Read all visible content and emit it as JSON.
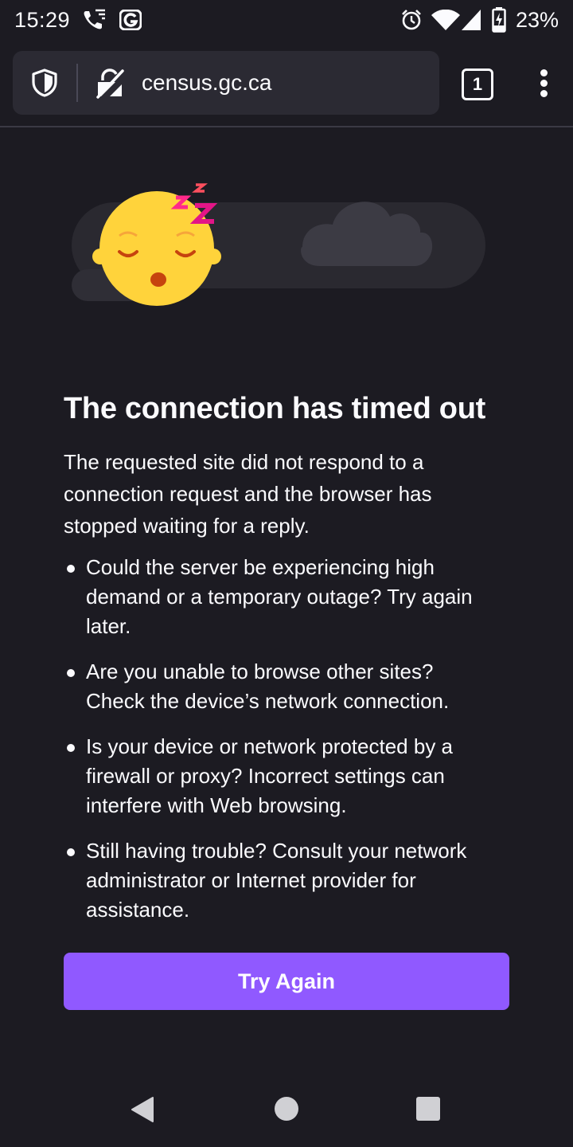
{
  "status_bar": {
    "time": "15:29",
    "battery_percent": "23%",
    "icons": [
      "wifi-calling-icon",
      "gmail-notification-icon",
      "alarm-icon",
      "wifi-icon",
      "cell-signal-icon",
      "battery-charging-icon"
    ]
  },
  "toolbar": {
    "url": "census.gc.ca",
    "tab_count": "1",
    "icons": [
      "tracking-protection-shield-icon",
      "insecure-connection-icon",
      "menu-kebab-icon"
    ]
  },
  "error_page": {
    "title": "The connection has timed out",
    "description": "The requested site did not respond to a connection request and the browser has stopped waiting for a reply.",
    "bullets": [
      "Could the server be experiencing high demand or a temporary outage? Try again later.",
      "Are you unable to browse other sites? Check the device’s network connection.",
      "Is your device or network protected by a firewall or proxy? Incorrect settings can interfere with Web browsing.",
      "Still having trouble? Consult your network administrator or Internet provider for assistance."
    ],
    "button_label": "Try Again"
  },
  "colors": {
    "background": "#1c1b22",
    "urlbar": "#2b2a33",
    "accent_button": "#9059ff",
    "text": "#fbfbfe"
  },
  "nav_bar": {
    "icons": [
      "back-icon",
      "home-icon",
      "recents-icon"
    ]
  }
}
